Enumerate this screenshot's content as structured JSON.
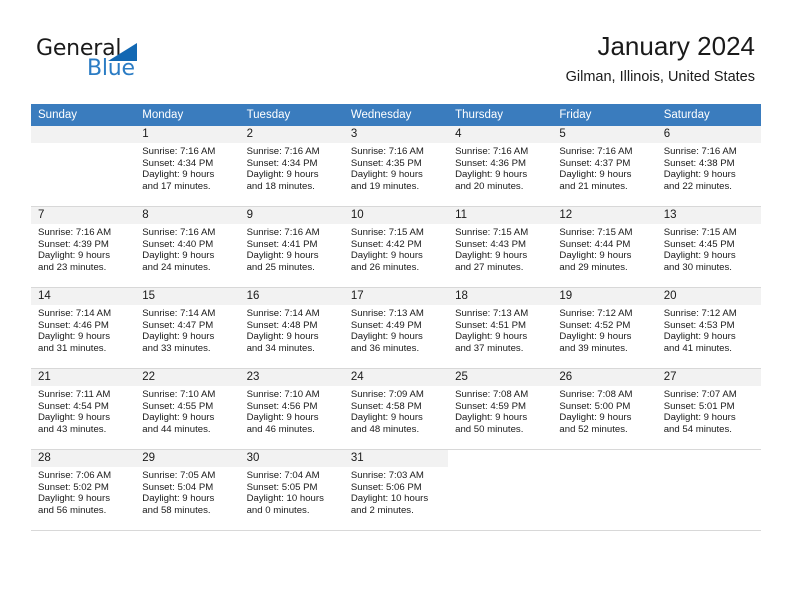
{
  "brand": {
    "name_part1": "General",
    "name_part2": "Blue",
    "accent_color": "#2b7cc4",
    "triangle_color": "#1268b3"
  },
  "header": {
    "title": "January 2024",
    "subtitle": "Gilman, Illinois, United States"
  },
  "theme": {
    "header_row_bg": "#3a7cbe",
    "day_number_bg": "#f2f2f2",
    "grid_line": "#d8d8d8"
  },
  "weekday_headers": [
    "Sunday",
    "Monday",
    "Tuesday",
    "Wednesday",
    "Thursday",
    "Friday",
    "Saturday"
  ],
  "weeks": [
    [
      {
        "day": "",
        "sunrise": "",
        "sunset": "",
        "daylight_line1": "",
        "daylight_line2": ""
      },
      {
        "day": "1",
        "sunrise": "Sunrise: 7:16 AM",
        "sunset": "Sunset: 4:34 PM",
        "daylight_line1": "Daylight: 9 hours",
        "daylight_line2": "and 17 minutes."
      },
      {
        "day": "2",
        "sunrise": "Sunrise: 7:16 AM",
        "sunset": "Sunset: 4:34 PM",
        "daylight_line1": "Daylight: 9 hours",
        "daylight_line2": "and 18 minutes."
      },
      {
        "day": "3",
        "sunrise": "Sunrise: 7:16 AM",
        "sunset": "Sunset: 4:35 PM",
        "daylight_line1": "Daylight: 9 hours",
        "daylight_line2": "and 19 minutes."
      },
      {
        "day": "4",
        "sunrise": "Sunrise: 7:16 AM",
        "sunset": "Sunset: 4:36 PM",
        "daylight_line1": "Daylight: 9 hours",
        "daylight_line2": "and 20 minutes."
      },
      {
        "day": "5",
        "sunrise": "Sunrise: 7:16 AM",
        "sunset": "Sunset: 4:37 PM",
        "daylight_line1": "Daylight: 9 hours",
        "daylight_line2": "and 21 minutes."
      },
      {
        "day": "6",
        "sunrise": "Sunrise: 7:16 AM",
        "sunset": "Sunset: 4:38 PM",
        "daylight_line1": "Daylight: 9 hours",
        "daylight_line2": "and 22 minutes."
      }
    ],
    [
      {
        "day": "7",
        "sunrise": "Sunrise: 7:16 AM",
        "sunset": "Sunset: 4:39 PM",
        "daylight_line1": "Daylight: 9 hours",
        "daylight_line2": "and 23 minutes."
      },
      {
        "day": "8",
        "sunrise": "Sunrise: 7:16 AM",
        "sunset": "Sunset: 4:40 PM",
        "daylight_line1": "Daylight: 9 hours",
        "daylight_line2": "and 24 minutes."
      },
      {
        "day": "9",
        "sunrise": "Sunrise: 7:16 AM",
        "sunset": "Sunset: 4:41 PM",
        "daylight_line1": "Daylight: 9 hours",
        "daylight_line2": "and 25 minutes."
      },
      {
        "day": "10",
        "sunrise": "Sunrise: 7:15 AM",
        "sunset": "Sunset: 4:42 PM",
        "daylight_line1": "Daylight: 9 hours",
        "daylight_line2": "and 26 minutes."
      },
      {
        "day": "11",
        "sunrise": "Sunrise: 7:15 AM",
        "sunset": "Sunset: 4:43 PM",
        "daylight_line1": "Daylight: 9 hours",
        "daylight_line2": "and 27 minutes."
      },
      {
        "day": "12",
        "sunrise": "Sunrise: 7:15 AM",
        "sunset": "Sunset: 4:44 PM",
        "daylight_line1": "Daylight: 9 hours",
        "daylight_line2": "and 29 minutes."
      },
      {
        "day": "13",
        "sunrise": "Sunrise: 7:15 AM",
        "sunset": "Sunset: 4:45 PM",
        "daylight_line1": "Daylight: 9 hours",
        "daylight_line2": "and 30 minutes."
      }
    ],
    [
      {
        "day": "14",
        "sunrise": "Sunrise: 7:14 AM",
        "sunset": "Sunset: 4:46 PM",
        "daylight_line1": "Daylight: 9 hours",
        "daylight_line2": "and 31 minutes."
      },
      {
        "day": "15",
        "sunrise": "Sunrise: 7:14 AM",
        "sunset": "Sunset: 4:47 PM",
        "daylight_line1": "Daylight: 9 hours",
        "daylight_line2": "and 33 minutes."
      },
      {
        "day": "16",
        "sunrise": "Sunrise: 7:14 AM",
        "sunset": "Sunset: 4:48 PM",
        "daylight_line1": "Daylight: 9 hours",
        "daylight_line2": "and 34 minutes."
      },
      {
        "day": "17",
        "sunrise": "Sunrise: 7:13 AM",
        "sunset": "Sunset: 4:49 PM",
        "daylight_line1": "Daylight: 9 hours",
        "daylight_line2": "and 36 minutes."
      },
      {
        "day": "18",
        "sunrise": "Sunrise: 7:13 AM",
        "sunset": "Sunset: 4:51 PM",
        "daylight_line1": "Daylight: 9 hours",
        "daylight_line2": "and 37 minutes."
      },
      {
        "day": "19",
        "sunrise": "Sunrise: 7:12 AM",
        "sunset": "Sunset: 4:52 PM",
        "daylight_line1": "Daylight: 9 hours",
        "daylight_line2": "and 39 minutes."
      },
      {
        "day": "20",
        "sunrise": "Sunrise: 7:12 AM",
        "sunset": "Sunset: 4:53 PM",
        "daylight_line1": "Daylight: 9 hours",
        "daylight_line2": "and 41 minutes."
      }
    ],
    [
      {
        "day": "21",
        "sunrise": "Sunrise: 7:11 AM",
        "sunset": "Sunset: 4:54 PM",
        "daylight_line1": "Daylight: 9 hours",
        "daylight_line2": "and 43 minutes."
      },
      {
        "day": "22",
        "sunrise": "Sunrise: 7:10 AM",
        "sunset": "Sunset: 4:55 PM",
        "daylight_line1": "Daylight: 9 hours",
        "daylight_line2": "and 44 minutes."
      },
      {
        "day": "23",
        "sunrise": "Sunrise: 7:10 AM",
        "sunset": "Sunset: 4:56 PM",
        "daylight_line1": "Daylight: 9 hours",
        "daylight_line2": "and 46 minutes."
      },
      {
        "day": "24",
        "sunrise": "Sunrise: 7:09 AM",
        "sunset": "Sunset: 4:58 PM",
        "daylight_line1": "Daylight: 9 hours",
        "daylight_line2": "and 48 minutes."
      },
      {
        "day": "25",
        "sunrise": "Sunrise: 7:08 AM",
        "sunset": "Sunset: 4:59 PM",
        "daylight_line1": "Daylight: 9 hours",
        "daylight_line2": "and 50 minutes."
      },
      {
        "day": "26",
        "sunrise": "Sunrise: 7:08 AM",
        "sunset": "Sunset: 5:00 PM",
        "daylight_line1": "Daylight: 9 hours",
        "daylight_line2": "and 52 minutes."
      },
      {
        "day": "27",
        "sunrise": "Sunrise: 7:07 AM",
        "sunset": "Sunset: 5:01 PM",
        "daylight_line1": "Daylight: 9 hours",
        "daylight_line2": "and 54 minutes."
      }
    ],
    [
      {
        "day": "28",
        "sunrise": "Sunrise: 7:06 AM",
        "sunset": "Sunset: 5:02 PM",
        "daylight_line1": "Daylight: 9 hours",
        "daylight_line2": "and 56 minutes."
      },
      {
        "day": "29",
        "sunrise": "Sunrise: 7:05 AM",
        "sunset": "Sunset: 5:04 PM",
        "daylight_line1": "Daylight: 9 hours",
        "daylight_line2": "and 58 minutes."
      },
      {
        "day": "30",
        "sunrise": "Sunrise: 7:04 AM",
        "sunset": "Sunset: 5:05 PM",
        "daylight_line1": "Daylight: 10 hours",
        "daylight_line2": "and 0 minutes."
      },
      {
        "day": "31",
        "sunrise": "Sunrise: 7:03 AM",
        "sunset": "Sunset: 5:06 PM",
        "daylight_line1": "Daylight: 10 hours",
        "daylight_line2": "and 2 minutes."
      },
      {
        "day": "",
        "sunrise": "",
        "sunset": "",
        "daylight_line1": "",
        "daylight_line2": ""
      },
      {
        "day": "",
        "sunrise": "",
        "sunset": "",
        "daylight_line1": "",
        "daylight_line2": ""
      },
      {
        "day": "",
        "sunrise": "",
        "sunset": "",
        "daylight_line1": "",
        "daylight_line2": ""
      }
    ]
  ]
}
